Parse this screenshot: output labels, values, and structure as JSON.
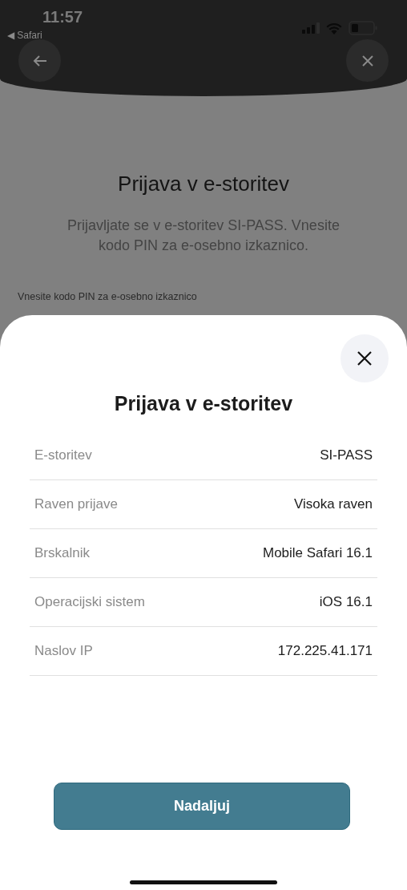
{
  "status_bar": {
    "time": "11:57",
    "back_app": "◀ Safari"
  },
  "background_page": {
    "title": "Prijava v e-storitev",
    "description": "Prijavljate se v e-storitev SI-PASS. Vnesite kodo PIN za e-osebno izkaznico.",
    "field_label": "Vnesite kodo PIN za e-osebno izkaznico"
  },
  "sheet": {
    "title": "Prijava v e-storitev",
    "rows": [
      {
        "label": "E-storitev",
        "value": "SI-PASS"
      },
      {
        "label": "Raven prijave",
        "value": "Visoka raven"
      },
      {
        "label": "Brskalnik",
        "value": "Mobile Safari 16.1"
      },
      {
        "label": "Operacijski sistem",
        "value": "iOS 16.1"
      },
      {
        "label": "Naslov IP",
        "value": "172.225.41.171"
      }
    ],
    "button": "Nadaljuj"
  }
}
